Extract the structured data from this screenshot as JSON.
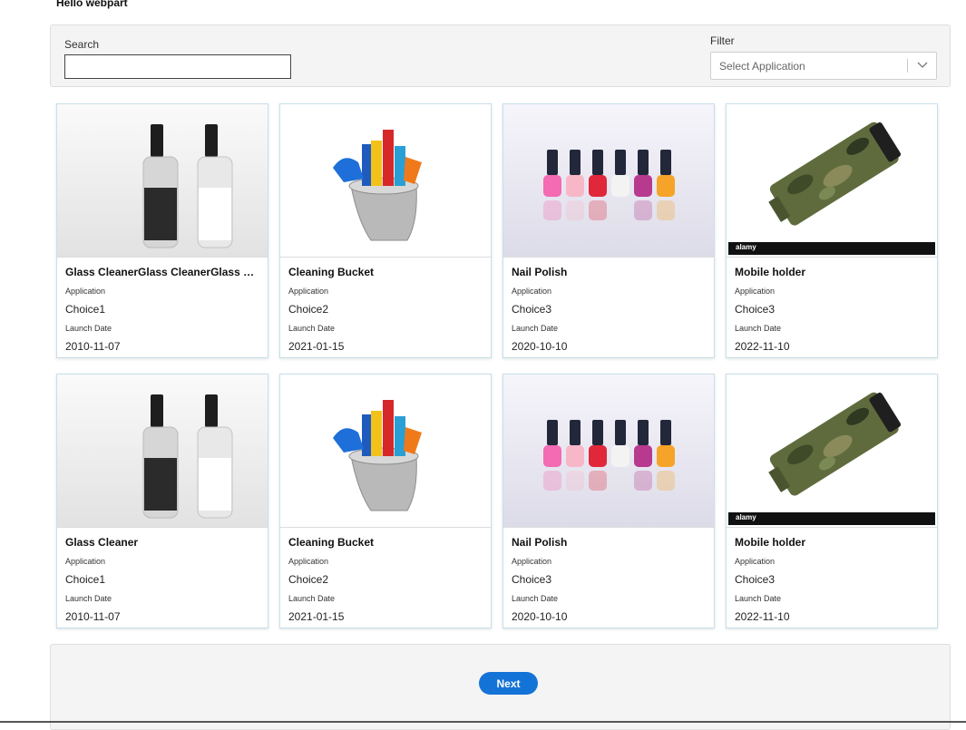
{
  "page": {
    "title": "Hello webpart"
  },
  "filters": {
    "search_label": "Search",
    "search_value": "",
    "filter_label": "Filter",
    "filter_placeholder": "Select Application"
  },
  "cards": [
    {
      "title": "Glass CleanerGlass CleanerGlass Clean...",
      "application_label": "Application",
      "application": "Choice1",
      "date_label": "Launch Date",
      "launch_date": "2010-11-07",
      "image": "spray-bottles-image"
    },
    {
      "title": "Cleaning Bucket",
      "application_label": "Application",
      "application": "Choice2",
      "date_label": "Launch Date",
      "launch_date": "2021-01-15",
      "image": "cleaning-bucket-image"
    },
    {
      "title": "Nail Polish",
      "application_label": "Application",
      "application": "Choice3",
      "date_label": "Launch Date",
      "launch_date": "2020-10-10",
      "image": "nail-polish-image"
    },
    {
      "title": "Mobile holder",
      "application_label": "Application",
      "application": "Choice3",
      "date_label": "Launch Date",
      "launch_date": "2022-11-10",
      "image": "mobile-holder-image"
    },
    {
      "title": "Glass Cleaner",
      "application_label": "Application",
      "application": "Choice1",
      "date_label": "Launch Date",
      "launch_date": "2010-11-07",
      "image": "spray-bottles-image"
    },
    {
      "title": "Cleaning Bucket",
      "application_label": "Application",
      "application": "Choice2",
      "date_label": "Launch Date",
      "launch_date": "2021-01-15",
      "image": "cleaning-bucket-image"
    },
    {
      "title": "Nail Polish",
      "application_label": "Application",
      "application": "Choice3",
      "date_label": "Launch Date",
      "launch_date": "2020-10-10",
      "image": "nail-polish-image"
    },
    {
      "title": "Mobile holder",
      "application_label": "Application",
      "application": "Choice3",
      "date_label": "Launch Date",
      "launch_date": "2022-11-10",
      "image": "mobile-holder-image"
    }
  ],
  "pagination": {
    "next_label": "Next"
  },
  "images": {
    "stock_banner_text": "alamy"
  },
  "colors": {
    "accent": "#1473d6",
    "card_border": "#c7e0ec",
    "panel_bg": "#f4f4f4"
  }
}
